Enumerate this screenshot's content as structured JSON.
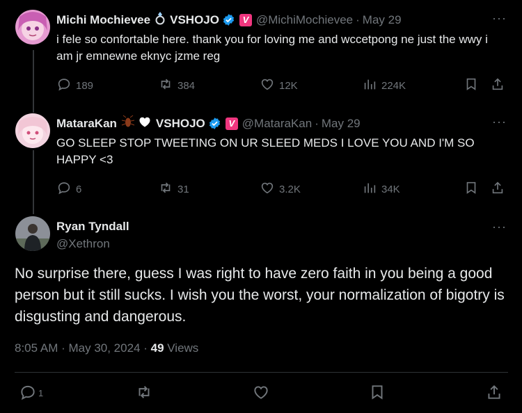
{
  "thread": [
    {
      "name": "Michi Mochievee",
      "affiliation": "VSHOJO",
      "name_emoji": "ring-emoji",
      "handle": "@MichiMochievee",
      "date": "May 29",
      "text": "i fele so confortable here. thank you for loving me and wccetpong ne just the wwy i am jr emnewne eknyc jzme reg",
      "replies": "189",
      "reposts": "384",
      "likes": "12K",
      "views": "224K"
    },
    {
      "name": "MataraKan",
      "affiliation": "VSHOJO",
      "name_emoji": "cockroach-heart-emoji",
      "handle": "@MataraKan",
      "date": "May 29",
      "text": "GO SLEEP STOP TWEETING ON UR SLEED MEDS I LOVE YOU AND I'M SO HAPPY <3",
      "replies": "6",
      "reposts": "31",
      "likes": "3.2K",
      "views": "34K"
    }
  ],
  "main_tweet": {
    "name": "Ryan Tyndall",
    "handle": "@Xethron",
    "text": "No surprise there, guess I was right to have zero faith in you being a good person but it still sucks. I wish you the worst, your normalization of bigotry is disgusting and dangerous.",
    "timestamp": "8:05 AM · May 30, 2024 · ",
    "views_count": "49",
    "views_label": " Views",
    "replies": "1"
  },
  "separator": "·",
  "more_glyph": "···",
  "badge_letter": "V",
  "colors": {
    "background": "#000000",
    "text": "#e7e9ea",
    "muted": "#71767b",
    "verified": "#1d9bf0",
    "vshojo_badge": "#f0367f"
  }
}
